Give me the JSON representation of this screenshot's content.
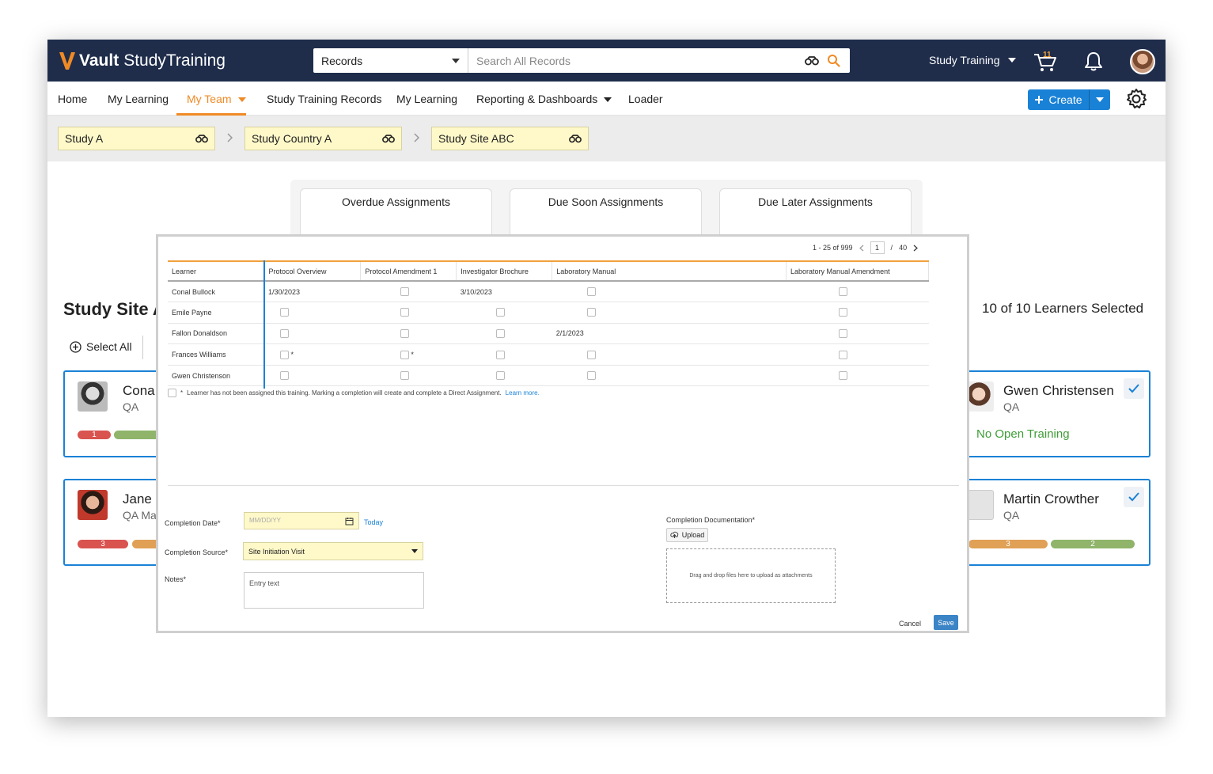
{
  "app": {
    "logo_bold": "Vault",
    "logo_rest": "StudyTraining"
  },
  "search": {
    "scope": "Records",
    "placeholder": "Search All Records"
  },
  "top": {
    "app_menu": "Study Training",
    "cart_count": "11"
  },
  "nav": {
    "items": [
      "Home",
      "My Learning",
      "My Team",
      "Study Training Records",
      "My Learning",
      "Reporting & Dashboards",
      "Loader"
    ],
    "create_label": "Create"
  },
  "breadcrumbs": [
    "Study A",
    "Study Country A",
    "Study Site ABC"
  ],
  "metrics": [
    {
      "label": "Overdue Assignments",
      "color": "#d9442f"
    },
    {
      "label": "Due Soon Assignments",
      "color": "#e07b1f"
    },
    {
      "label": "Due Later Assignments",
      "color": "#3e9d37"
    }
  ],
  "page": {
    "study_site_title": "Study Site A",
    "selected_count": "10 of 10 Learners Selected",
    "select_all": "Select All"
  },
  "cards": [
    {
      "name": "Cona",
      "role": "QA",
      "pills": [
        "1",
        ""
      ]
    },
    {
      "name": "Jane",
      "role": "QA Ma",
      "pills": [
        "3",
        ""
      ]
    },
    {
      "name": "Gwen Christensen",
      "role": "QA",
      "status": "No Open Training"
    },
    {
      "name": "Martin Crowther",
      "role": "QA",
      "pills": [
        "3",
        "2"
      ]
    }
  ],
  "grid": {
    "pager": {
      "range": "1 - 25 of 999",
      "page": "1",
      "sep": "/",
      "total": "40"
    },
    "columns": [
      "Learner",
      "Protocol Overview",
      "Protocol Amendment 1",
      "Investigator Brochure",
      "Laboratory Manual",
      "Laboratory Manual Amendment"
    ],
    "rows": [
      {
        "learner": "Conal Bullock",
        "cells": [
          "1/30/2023",
          "",
          "3/10/2023",
          "",
          ""
        ]
      },
      {
        "learner": "Emile Payne",
        "cells": [
          "",
          "",
          "",
          "",
          ""
        ]
      },
      {
        "learner": "Fallon Donaldson",
        "cells": [
          "",
          "",
          "",
          "2/1/2023",
          ""
        ]
      },
      {
        "learner": "Frances Williams",
        "cells": [
          "*",
          "*",
          "",
          "",
          ""
        ]
      },
      {
        "learner": "Gwen Christenson",
        "cells": [
          "",
          "",
          "",
          "",
          ""
        ]
      }
    ],
    "footnote_star": "*",
    "footnote_text": "Learner has not been assigned this training. Marking a completion will create and complete a Direct Assignment.",
    "footnote_link": "Learn more."
  },
  "form": {
    "completion_date_label": "Completion Date*",
    "date_placeholder": "MM/DD/YY",
    "today": "Today",
    "completion_source_label": "Completion Source*",
    "completion_source_value": "Site Initiation Visit",
    "notes_label": "Notes*",
    "notes_placeholder": "Entry text",
    "documentation_label": "Completion Documentation*",
    "upload_label": "Upload",
    "dropzone_text": "Drag and drop files here to upload as attachments",
    "cancel": "Cancel",
    "save": "Save"
  }
}
